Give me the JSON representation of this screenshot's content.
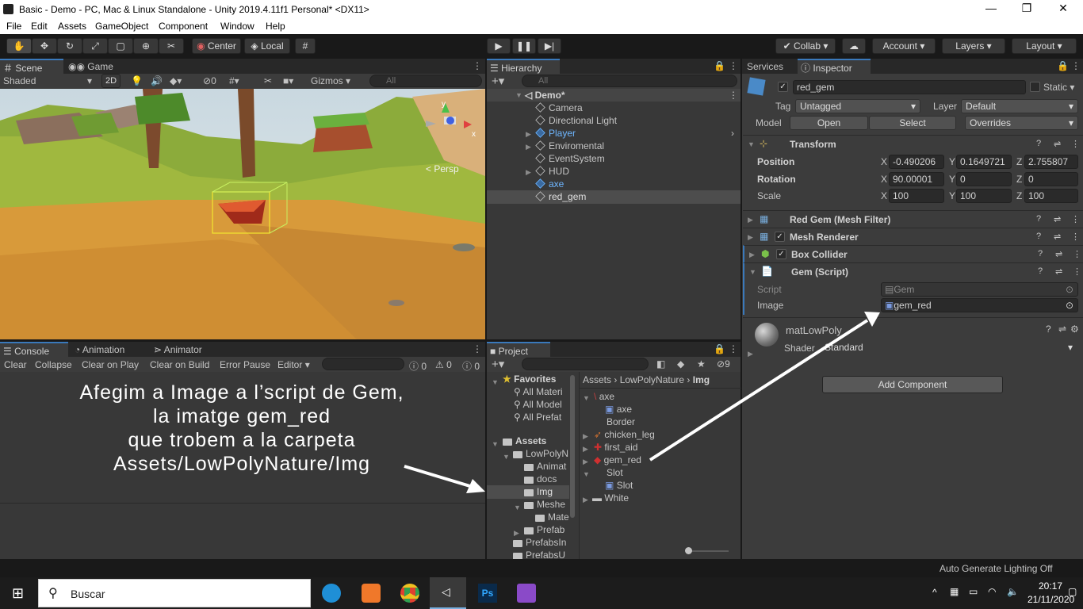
{
  "window": {
    "title": "Basic - Demo - PC, Mac & Linux Standalone - Unity 2019.4.11f1 Personal* <DX11>",
    "min": "—",
    "max": "❐",
    "close": "✕"
  },
  "menu": [
    "File",
    "Edit",
    "Assets",
    "GameObject",
    "Component",
    "Window",
    "Help"
  ],
  "toolbar": {
    "center": "Center",
    "local": "Local",
    "collab": "Collab",
    "account": "Account",
    "layers": "Layers",
    "layout": "Layout"
  },
  "scene": {
    "tab_scene": "Scene",
    "tab_game": "Game",
    "shading": "Shaded",
    "mode2d": "2D",
    "hidden": "0",
    "gizmos": "Gizmos",
    "search": "All",
    "persp": "< Persp"
  },
  "hierarchy": {
    "tab": "Hierarchy",
    "search": "All",
    "root": "Demo*",
    "items": [
      "Camera",
      "Directional Light",
      "Player",
      "Enviromental",
      "EventSystem",
      "HUD",
      "axe",
      "red_gem"
    ]
  },
  "inspector": {
    "tab_services": "Services",
    "tab_inspector": "Inspector",
    "name": "red_gem",
    "static": "Static",
    "tag_label": "Tag",
    "tag": "Untagged",
    "layer_label": "Layer",
    "layer": "Default",
    "model_label": "Model",
    "open": "Open",
    "select": "Select",
    "overrides": "Overrides",
    "transform": {
      "title": "Transform",
      "position": "Position",
      "rotation": "Rotation",
      "scale": "Scale",
      "px": "-0.490206",
      "py": "0.1649721",
      "pz": "2.755807",
      "rx": "90.00001",
      "ry": "0",
      "rz": "0",
      "sx": "100",
      "sy": "100",
      "sz": "100"
    },
    "components": [
      "Red Gem (Mesh Filter)",
      "Mesh Renderer",
      "Box Collider",
      "Gem (Script)"
    ],
    "script_label": "Script",
    "script_value": "Gem",
    "image_label": "Image",
    "image_value": "gem_red",
    "material": "matLowPoly",
    "shader_label": "Shader",
    "shader": "Standard",
    "add_component": "Add Component"
  },
  "console": {
    "tab_console": "Console",
    "tab_animation": "Animation",
    "tab_animator": "Animator",
    "clear": "Clear",
    "collapse": "Collapse",
    "clear_on_play": "Clear on Play",
    "clear_on_build": "Clear on Build",
    "error_pause": "Error Pause",
    "editor": "Editor",
    "c1": "0",
    "c2": "0",
    "c3": "0"
  },
  "annotation": {
    "line1": "Afegim a Image a l’script de Gem,",
    "line2": "la imatge gem_red",
    "line3": "que trobem a la carpeta",
    "line4": "Assets/LowPolyNature/Img"
  },
  "project": {
    "tab": "Project",
    "hidden": "9",
    "favorites": "Favorites",
    "fav_items": [
      "All Materi",
      "All Model",
      "All Prefat"
    ],
    "assets": "Assets",
    "tree": [
      "LowPolyN",
      "Animat",
      "docs",
      "Img",
      "Meshe",
      "Mate",
      "Prefab",
      "PrefabsIn",
      "PrefabsU"
    ],
    "breadcrumb": [
      "Assets",
      "LowPolyNature",
      "Img"
    ],
    "files": [
      "axe",
      "axe",
      "Border",
      "chicken_leg",
      "first_aid",
      "gem_red",
      "Slot",
      "Slot",
      "White"
    ]
  },
  "status": {
    "lighting": "Auto Generate Lighting Off"
  },
  "taskbar": {
    "search": "Buscar",
    "time": "20:17",
    "date": "21/11/2020"
  }
}
